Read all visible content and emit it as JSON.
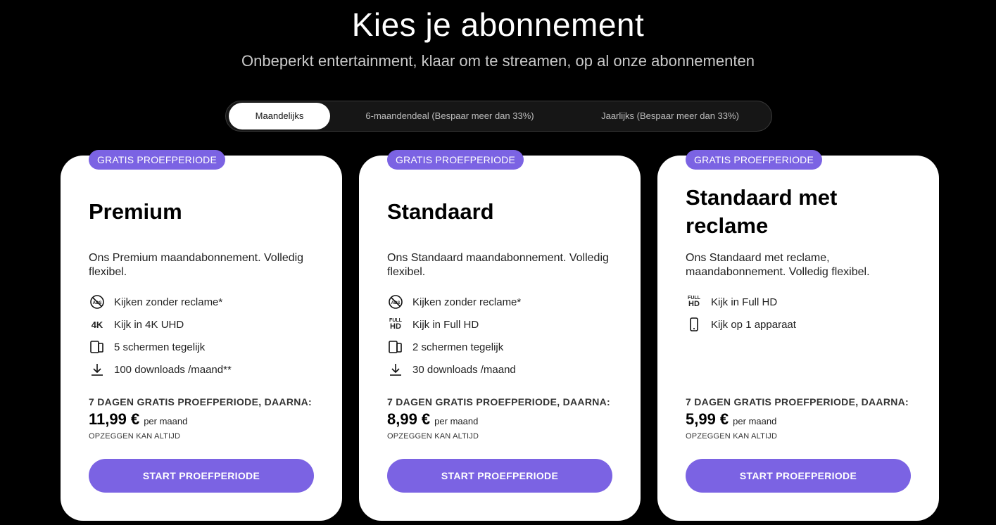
{
  "header": {
    "title": "Kies je abonnement",
    "subtitle": "Onbeperkt entertainment, klaar om te streamen, op al onze abonnementen"
  },
  "billing_toggle": {
    "options": [
      {
        "label": "Maandelijks",
        "active": true
      },
      {
        "label": "6-maandendeal (Bespaar meer dan 33%)",
        "active": false
      },
      {
        "label": "Jaarlijks (Bespaar meer dan 33%)",
        "active": false
      }
    ]
  },
  "plans": [
    {
      "badge": "GRATIS PROEFPERIODE",
      "name": "Premium",
      "description": "Ons Premium maandabonnement. Volledig flexibel.",
      "features": [
        {
          "icon": "no-ads-icon",
          "label": "Kijken zonder reclame*"
        },
        {
          "icon": "4k-icon",
          "label": "Kijk in 4K UHD"
        },
        {
          "icon": "multi-screen-icon",
          "label": "5 schermen tegelijk"
        },
        {
          "icon": "download-icon",
          "label": "100 downloads /maand**"
        }
      ],
      "trial_note": "7 DAGEN GRATIS PROEFPERIODE, DAARNA:",
      "price": "11,99 €",
      "price_period": "per maand",
      "cancel_note": "OPZEGGEN KAN ALTIJD",
      "cta": "START PROEFPERIODE"
    },
    {
      "badge": "GRATIS PROEFPERIODE",
      "name": "Standaard",
      "description": "Ons Standaard maandabonnement. Volledig flexibel.",
      "features": [
        {
          "icon": "no-ads-icon",
          "label": "Kijken zonder reclame*"
        },
        {
          "icon": "full-hd-icon",
          "label": "Kijk in Full HD"
        },
        {
          "icon": "multi-screen-icon",
          "label": "2 schermen tegelijk"
        },
        {
          "icon": "download-icon",
          "label": "30 downloads /maand"
        }
      ],
      "trial_note": "7 DAGEN GRATIS PROEFPERIODE, DAARNA:",
      "price": "8,99 €",
      "price_period": "per maand",
      "cancel_note": "OPZEGGEN KAN ALTIJD",
      "cta": "START PROEFPERIODE"
    },
    {
      "badge": "GRATIS PROEFPERIODE",
      "name": "Standaard met reclame",
      "description": "Ons Standaard met reclame, maandabonnement. Volledig flexibel.",
      "features": [
        {
          "icon": "full-hd-icon",
          "label": "Kijk in Full HD"
        },
        {
          "icon": "phone-icon",
          "label": "Kijk op 1 apparaat"
        }
      ],
      "trial_note": "7 DAGEN GRATIS PROEFPERIODE, DAARNA:",
      "price": "5,99 €",
      "price_period": "per maand",
      "cancel_note": "OPZEGGEN KAN ALTIJD",
      "cta": "START PROEFPERIODE"
    }
  ],
  "colors": {
    "accent": "#7b63e3",
    "background": "#000000",
    "card": "#ffffff"
  }
}
